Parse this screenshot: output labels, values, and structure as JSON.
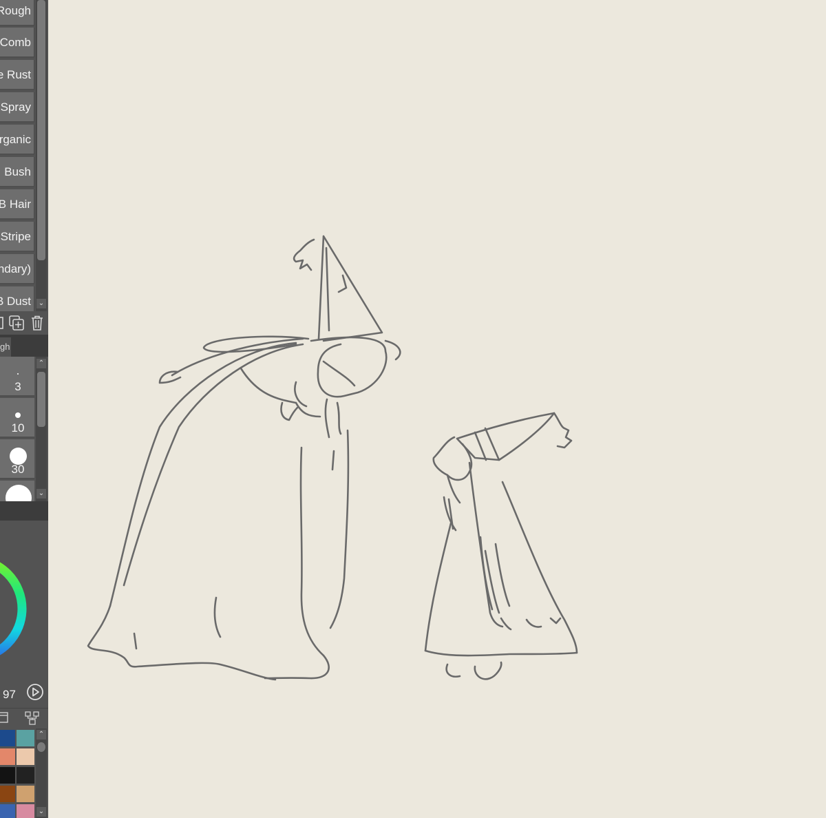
{
  "brush_list": {
    "items": [
      {
        "label": "Rough"
      },
      {
        "label": "Comb"
      },
      {
        "label": "e Rust"
      },
      {
        "label": "Spray"
      },
      {
        "label": "rganic"
      },
      {
        "label": "Bush"
      },
      {
        "label": "B Hair"
      },
      {
        "label": "Stripe"
      },
      {
        "label": "ndary)"
      },
      {
        "label": "B Dust"
      }
    ]
  },
  "panel_tab": {
    "label": "gh"
  },
  "brush_size": {
    "items": [
      {
        "label": "3"
      },
      {
        "label": "10"
      },
      {
        "label": "30"
      },
      {
        "label": ""
      }
    ]
  },
  "color": {
    "value_label": "97",
    "swatches": [
      "#1c4a8c",
      "#5aa2a2",
      "#e3876a",
      "#ecc9ac",
      "#131313",
      "#222222",
      "#8a4512",
      "#cfa16f",
      "#3a64b0",
      "#d78aa0"
    ]
  },
  "canvas": {
    "background": "#ece8dd",
    "stroke_color": "#6a6a6a"
  }
}
